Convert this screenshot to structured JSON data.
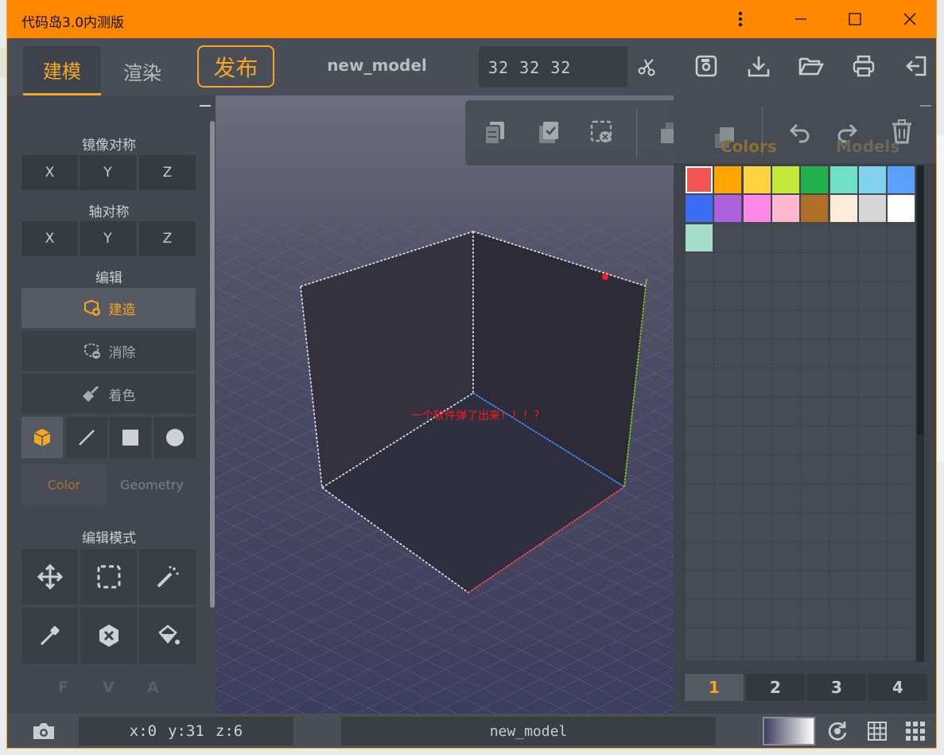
{
  "window": {
    "title": "代码岛3.0内测版",
    "controls": [
      "more-icon",
      "minimize-icon",
      "maximize-icon",
      "close-icon"
    ]
  },
  "topbar": {
    "tabs": [
      {
        "label": "建模",
        "active": true
      },
      {
        "label": "渲染",
        "active": false
      }
    ],
    "publish_label": "发布",
    "model_name": "new_model",
    "size_value": "32 32 32",
    "toolbar_icons": [
      "save-icon",
      "download-icon",
      "open-folder-icon",
      "print-icon",
      "exit-icon"
    ]
  },
  "left_panel": {
    "mirror_title": "镜像对称",
    "mirror_buttons": [
      "X",
      "Y",
      "Z"
    ],
    "axis_title": "轴对称",
    "axis_buttons": [
      "X",
      "Y",
      "Z"
    ],
    "edit_title": "编辑",
    "edit_buttons": [
      {
        "label": "建造",
        "icon": "build-icon",
        "active": true
      },
      {
        "label": "消除",
        "icon": "erase-icon",
        "active": false
      },
      {
        "label": "着色",
        "icon": "paint-icon",
        "active": false
      }
    ],
    "shapes": [
      "cube-icon",
      "line-icon",
      "square-icon",
      "circle-icon"
    ],
    "subtabs": [
      {
        "label": "Color",
        "active": true
      },
      {
        "label": "Geometry",
        "active": false
      }
    ],
    "mode_title": "编辑模式",
    "modes": [
      "move-icon",
      "select-icon",
      "magic-wand-icon",
      "eyedropper-icon",
      "clear-icon",
      "fill-bucket-icon"
    ],
    "fva": [
      "F",
      "V",
      "A"
    ]
  },
  "viewport": {
    "message": "一个软件弹了出来！！！？",
    "float_toolbar": [
      "copy-icon",
      "paste-icon",
      "delete-selection-icon",
      "layer-back-icon",
      "layer-front-icon",
      "undo-icon",
      "redo-icon",
      "trash-icon"
    ]
  },
  "right_panel": {
    "tabs": [
      "Colors",
      "Models"
    ],
    "colors": [
      "#f25454",
      "#ffa500",
      "#ffd23f",
      "#c5e83a",
      "#22b14c",
      "#6ee0c4",
      "#7fd3ee",
      "#5aa0ff",
      "#3b6cf2",
      "#ad61dd",
      "#ff87e8",
      "#ffb6cf",
      "#b06e26",
      "#ffecd9",
      "#d6d6d6",
      "#ffffff",
      "#a6dcca"
    ],
    "selected_color": 0,
    "pages": [
      "1",
      "2",
      "3",
      "4"
    ],
    "active_page": 0
  },
  "bottombar": {
    "coord_x": "x:0",
    "coord_y": "y:31",
    "coord_z": "z:6",
    "model_name": "new_model",
    "icons": [
      "camera-icon",
      "rotate-icon",
      "grid-icon",
      "grid-dense-icon"
    ]
  }
}
